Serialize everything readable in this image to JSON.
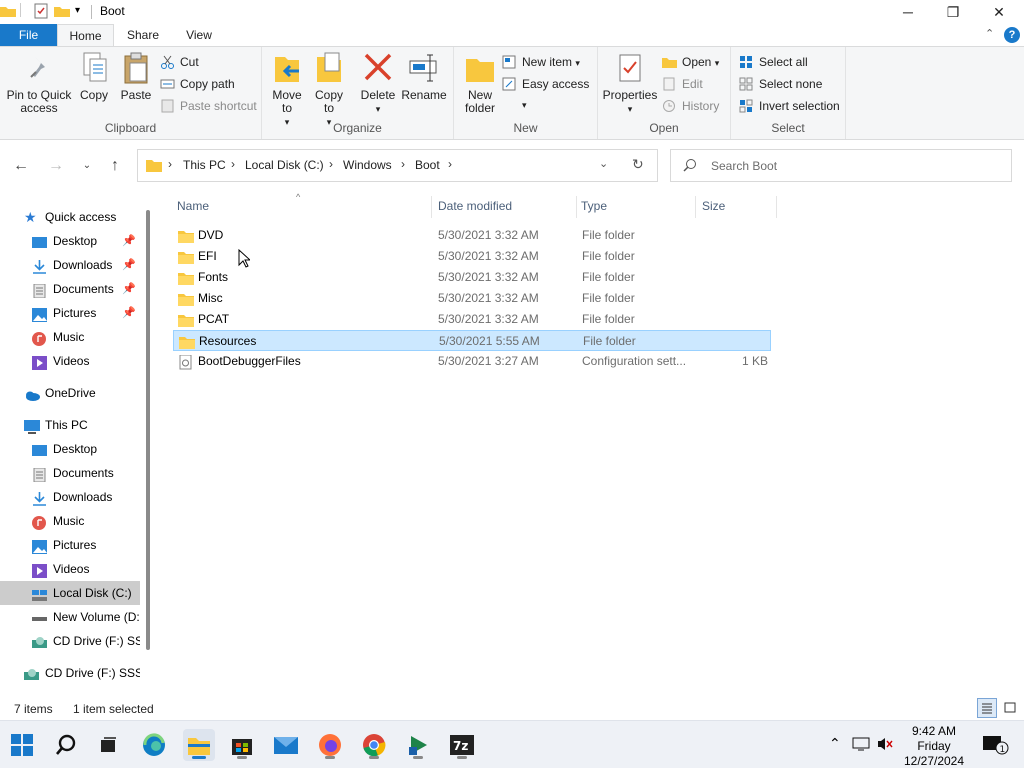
{
  "window": {
    "title": "Boot",
    "controls": {
      "minimize": "─",
      "maximize": "❐",
      "close": "✕"
    }
  },
  "ribbon_tabs": [
    {
      "label": "File"
    },
    {
      "label": "Home"
    },
    {
      "label": "Share"
    },
    {
      "label": "View"
    }
  ],
  "ribbon": {
    "clipboard": {
      "label": "Clipboard",
      "pin": "Pin to Quick access",
      "copy": "Copy",
      "paste": "Paste",
      "cut": "Cut",
      "copy_path": "Copy path",
      "paste_shortcut": "Paste shortcut"
    },
    "organize": {
      "label": "Organize",
      "move_to": "Move to",
      "copy_to": "Copy to",
      "delete": "Delete",
      "rename": "Rename"
    },
    "new": {
      "label": "New",
      "new_folder": "New folder",
      "new_item": "New item",
      "easy_access": "Easy access"
    },
    "open": {
      "label": "Open",
      "properties": "Properties",
      "open": "Open",
      "edit": "Edit",
      "history": "History"
    },
    "select": {
      "label": "Select",
      "select_all": "Select all",
      "select_none": "Select none",
      "invert": "Invert selection"
    }
  },
  "address": {
    "crumbs": [
      "This PC",
      "Local Disk (C:)",
      "Windows",
      "Boot"
    ],
    "search_placeholder": "Search Boot"
  },
  "nav": {
    "quick_access": "Quick access",
    "quick_items": [
      "Desktop",
      "Downloads",
      "Documents",
      "Pictures",
      "Music",
      "Videos"
    ],
    "onedrive": "OneDrive",
    "this_pc": "This PC",
    "pc_items": [
      "Desktop",
      "Documents",
      "Downloads",
      "Music",
      "Pictures",
      "Videos",
      "Local Disk (C:)",
      "New Volume (D:",
      "CD Drive (F:) SSS"
    ],
    "cd_drive": "CD Drive (F:) SSS_"
  },
  "columns": {
    "name": "Name",
    "date": "Date modified",
    "type": "Type",
    "size": "Size"
  },
  "files": [
    {
      "name": "DVD",
      "date": "5/30/2021 3:32 AM",
      "type": "File folder",
      "size": "",
      "kind": "folder"
    },
    {
      "name": "EFI",
      "date": "5/30/2021 3:32 AM",
      "type": "File folder",
      "size": "",
      "kind": "folder"
    },
    {
      "name": "Fonts",
      "date": "5/30/2021 3:32 AM",
      "type": "File folder",
      "size": "",
      "kind": "folder"
    },
    {
      "name": "Misc",
      "date": "5/30/2021 3:32 AM",
      "type": "File folder",
      "size": "",
      "kind": "folder"
    },
    {
      "name": "PCAT",
      "date": "5/30/2021 3:32 AM",
      "type": "File folder",
      "size": "",
      "kind": "folder"
    },
    {
      "name": "Resources",
      "date": "5/30/2021 5:55 AM",
      "type": "File folder",
      "size": "",
      "kind": "folder",
      "selected": true
    },
    {
      "name": "BootDebuggerFiles",
      "date": "5/30/2021 3:27 AM",
      "type": "Configuration sett...",
      "size": "1 KB",
      "kind": "config"
    }
  ],
  "status": {
    "count": "7 items",
    "selected": "1 item selected"
  },
  "taskbar": {
    "time": "9:42 AM",
    "day": "Friday",
    "date": "12/27/2024",
    "apps": [
      "windows-start-icon",
      "search-icon",
      "task-view-icon",
      "edge-icon",
      "file-explorer-icon",
      "store-icon",
      "mail-icon",
      "firefox-icon",
      "chrome-icon",
      "media-player-icon",
      "7zip-icon"
    ]
  },
  "colors": {
    "accent": "#1979ca",
    "selected_row": "#cce8ff",
    "folder": "#f8c73e"
  }
}
